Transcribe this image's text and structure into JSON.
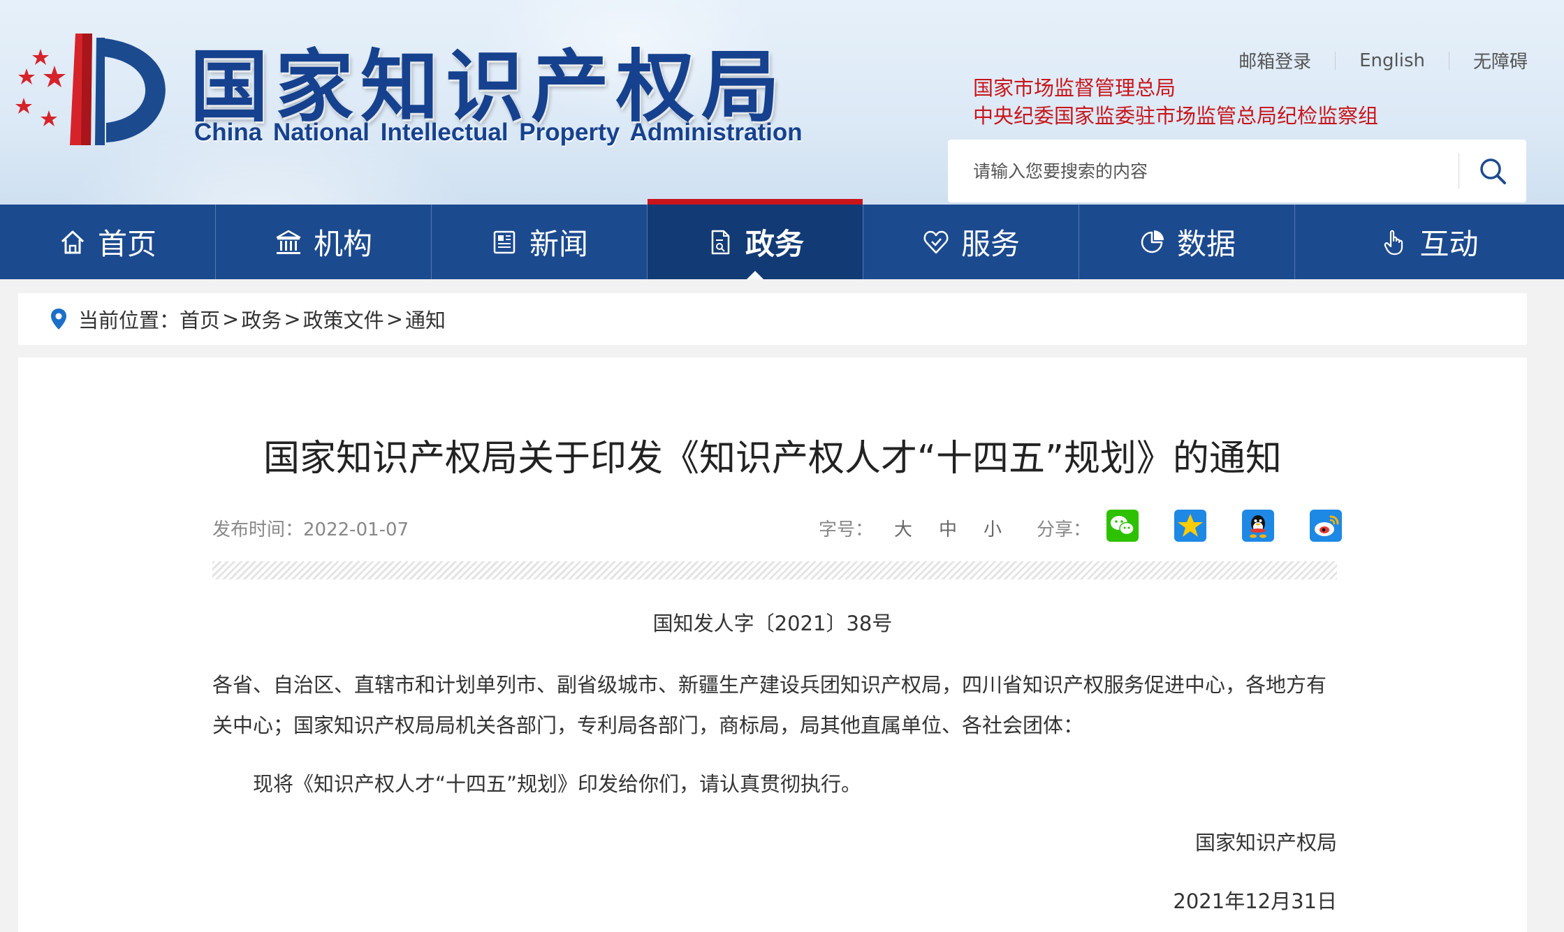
{
  "header": {
    "title_cn": "国家知识产权局",
    "title_en": "China National Intellectual Property Administration",
    "top_links": [
      "邮箱登录",
      "English",
      "无障碍"
    ],
    "org_links": [
      "国家市场监督管理总局",
      "中央纪委国家监委驻市场监管总局纪检监察组"
    ],
    "search": {
      "placeholder": "请输入您要搜索的内容",
      "icon": "search-icon"
    },
    "brand_color": "#1c4a8f",
    "accent_color": "#c8151b"
  },
  "nav": {
    "active": "政务",
    "items": [
      {
        "label": "首页",
        "icon": "home-icon"
      },
      {
        "label": "机构",
        "icon": "institution-icon"
      },
      {
        "label": "新闻",
        "icon": "newspaper-icon"
      },
      {
        "label": "政务",
        "icon": "document-icon"
      },
      {
        "label": "服务",
        "icon": "service-icon"
      },
      {
        "label": "数据",
        "icon": "chart-pie-icon"
      },
      {
        "label": "互动",
        "icon": "hand-pointer-icon"
      }
    ]
  },
  "breadcrumb": {
    "prefix": "当前位置：",
    "items": [
      "首页",
      "政务",
      "政策文件",
      "通知"
    ],
    "separator": ">"
  },
  "article": {
    "title": "国家知识产权局关于印发《知识产权人才“十四五”规划》的通知",
    "publish_label": "发布时间：",
    "publish_date": "2022-01-07",
    "font_size_label": "字号：",
    "font_sizes": [
      "大",
      "中",
      "小"
    ],
    "share_label": "分享：",
    "share_targets": [
      "wechat-icon",
      "qzone-icon",
      "qq-icon",
      "weibo-icon"
    ],
    "doc_number": "国知发人字〔2021〕38号",
    "recipients": "各省、自治区、直辖市和计划单列市、副省级城市、新疆生产建设兵团知识产权局，四川省知识产权服务促进中心，各地方有关中心；国家知识产权局局机关各部门，专利局各部门，商标局，局其他直属单位、各社会团体：",
    "body": "现将《知识产权人才“十四五”规划》印发给你们，请认真贯彻执行。",
    "signature_org": "国家知识产权局",
    "signature_date": "2021年12月31日"
  }
}
